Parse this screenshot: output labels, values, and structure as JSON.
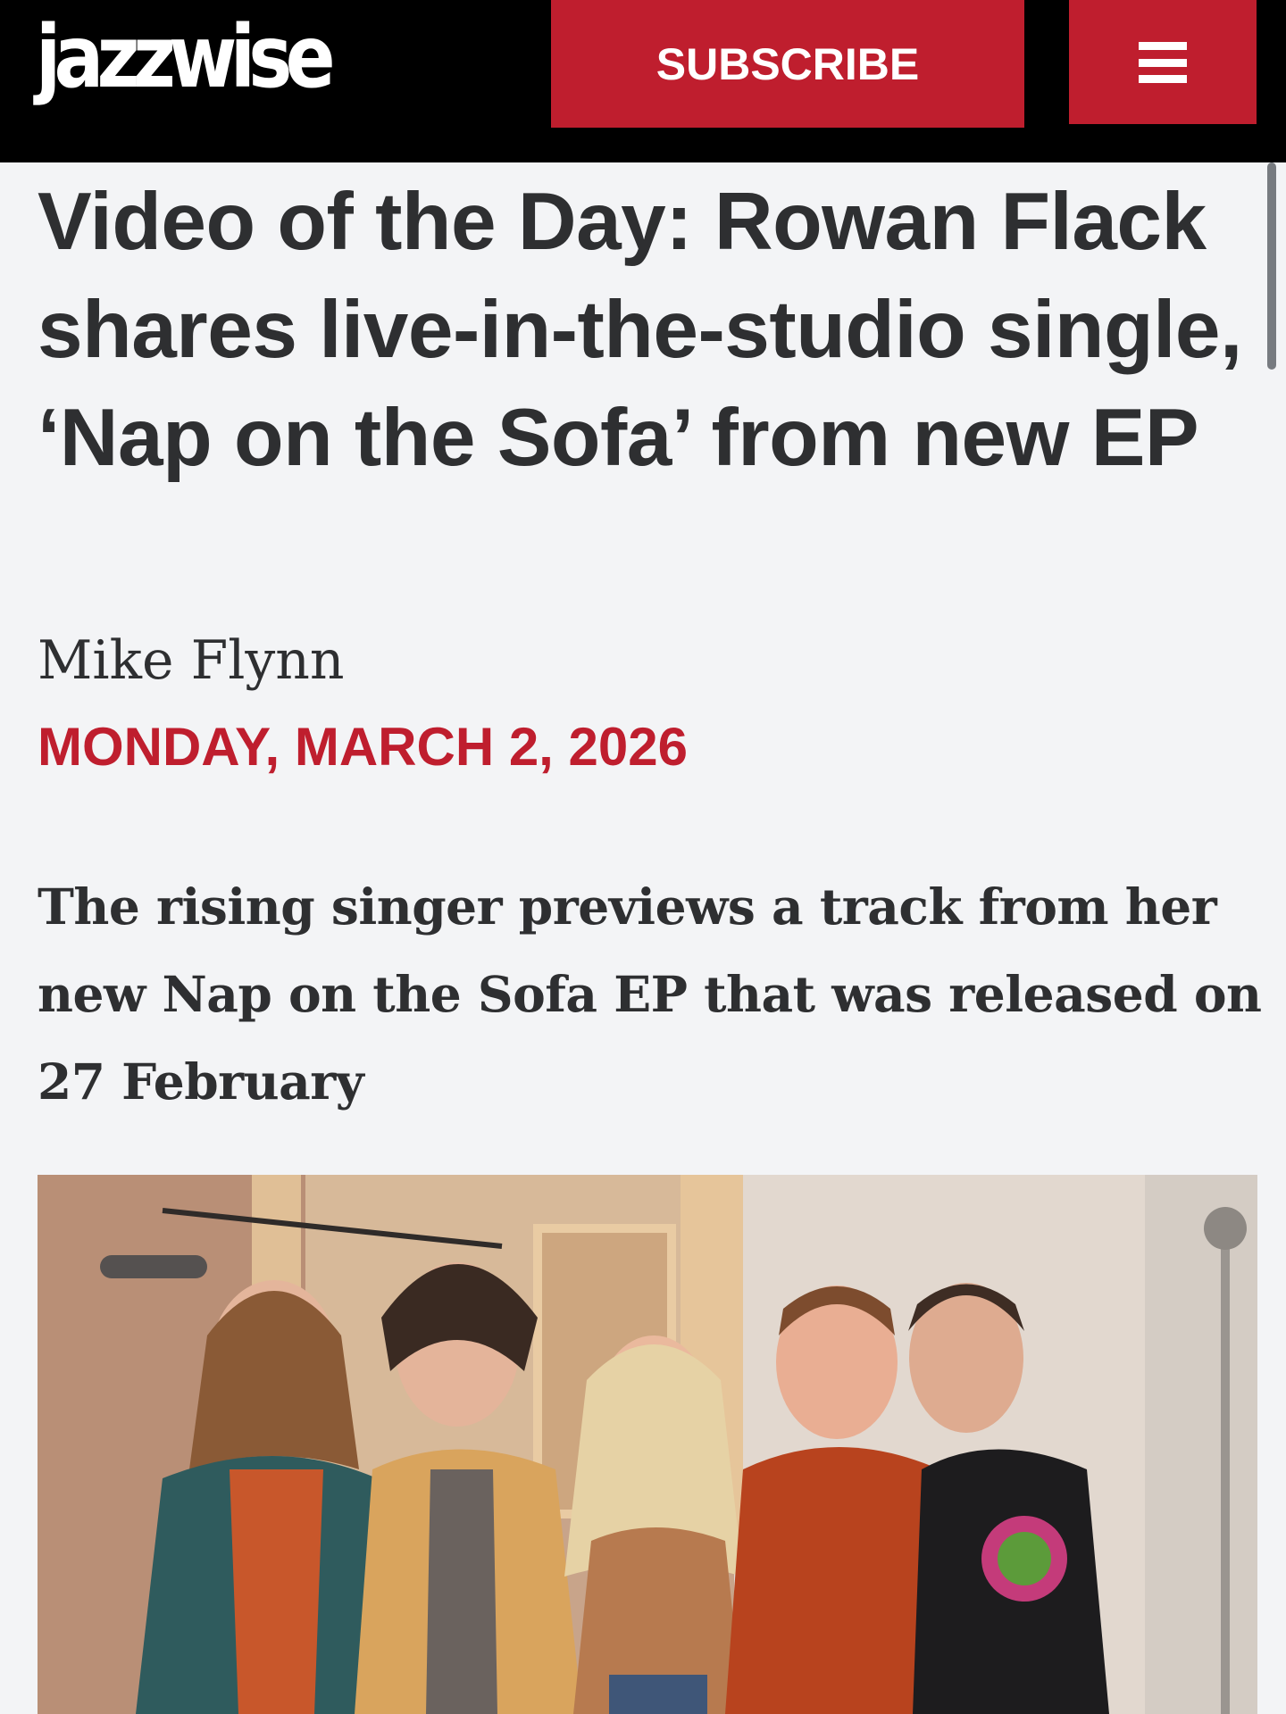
{
  "header": {
    "logo_text": "jazzwise",
    "subscribe_label": "SUBSCRIBE",
    "menu_icon": "hamburger-menu-icon"
  },
  "article": {
    "headline": "Video of the Day: Rowan Flack shares live-in-the-studio single, ‘Nap on the Sofa’ from new EP",
    "author": "Mike Flynn",
    "date": "MONDAY, MARCH 2, 2026",
    "standfirst": "The rising singer previews a track from her new Nap on the Sofa EP that was released on 27 February"
  },
  "colors": {
    "brand_red": "#bf1e2e",
    "header_black": "#000000",
    "page_background": "#f3f4f6",
    "text_dark": "#2e2f31"
  }
}
